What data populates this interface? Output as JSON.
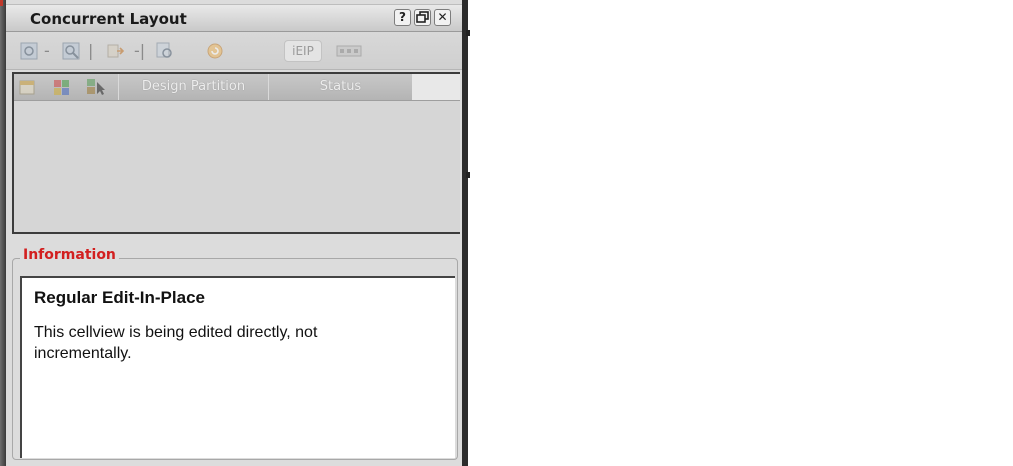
{
  "window": {
    "title": "Concurrent Layout",
    "buttons": {
      "help": "?",
      "float": "",
      "close": "✕"
    }
  },
  "toolbar": {
    "icons": [
      "zoom-fit-icon",
      "zoom-in-icon",
      "push-icon",
      "pop-icon",
      "edit-icon",
      "refresh-icon",
      "ieip-button",
      "config-icon"
    ],
    "ieip_label": "iEIP",
    "separators": [
      "-",
      "|",
      "-|"
    ]
  },
  "partition_table": {
    "header_icons": [
      "new-partition-icon",
      "partition-color-icon",
      "select-partition-icon"
    ],
    "columns": [
      "Design Partition",
      "Status"
    ],
    "rows": []
  },
  "information": {
    "legend": "Information",
    "title": "Regular Edit-In-Place",
    "body": "This cellview is being edited directly, not incrementally."
  }
}
